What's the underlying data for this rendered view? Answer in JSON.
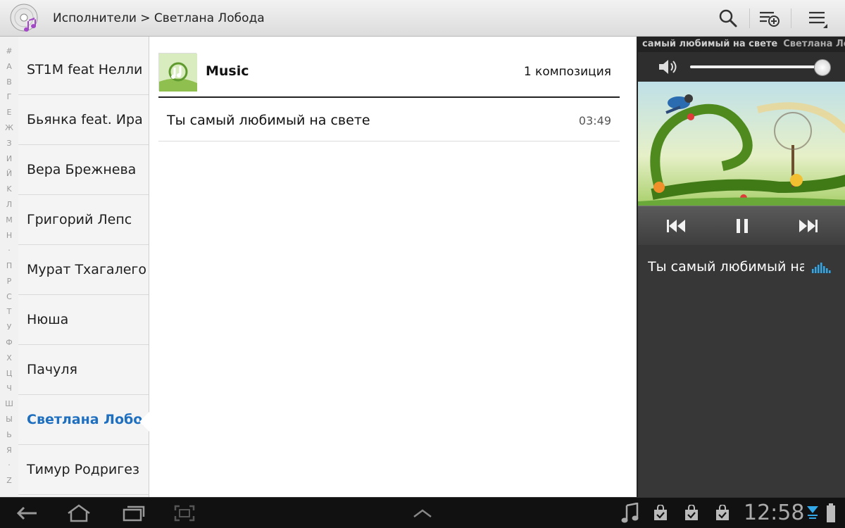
{
  "header": {
    "breadcrumb": "Исполнители > Светлана Лобода"
  },
  "index_letters": [
    "#",
    "A",
    "B",
    "Г",
    "E",
    "Ж",
    "З",
    "И",
    "Й",
    "K",
    "Л",
    "M",
    "H",
    "·",
    "П",
    "P",
    "C",
    "T",
    "У",
    "Ф",
    "X",
    "Ц",
    "Ч",
    "Ш",
    "Ы",
    "Ь",
    "Я",
    "·",
    "Z"
  ],
  "artists": [
    {
      "label": "ST1M feat Нелли"
    },
    {
      "label": "Бьянка feat. Ира"
    },
    {
      "label": "Вера Брежнева"
    },
    {
      "label": "Григорий Лепс"
    },
    {
      "label": "Мурат Тхагалего"
    },
    {
      "label": "Нюша"
    },
    {
      "label": "Пачуля"
    },
    {
      "label": "Светлана Лобода"
    },
    {
      "label": "Тимур Родригез"
    }
  ],
  "selected_artist_index": 7,
  "album": {
    "title": "Music",
    "track_count": "1 композиция"
  },
  "tracks": [
    {
      "title": "Ты самый любимый на свете",
      "duration": "03:49"
    }
  ],
  "now_playing": {
    "ticker_title": "самый любимый на свете",
    "ticker_artist": "Светлана Лобод",
    "title": "Ты самый любимый на",
    "volume_fraction": 0.98
  },
  "system": {
    "clock": "12:58"
  },
  "colors": {
    "accent": "#1e6fc0",
    "eq": "#33a8e8"
  }
}
